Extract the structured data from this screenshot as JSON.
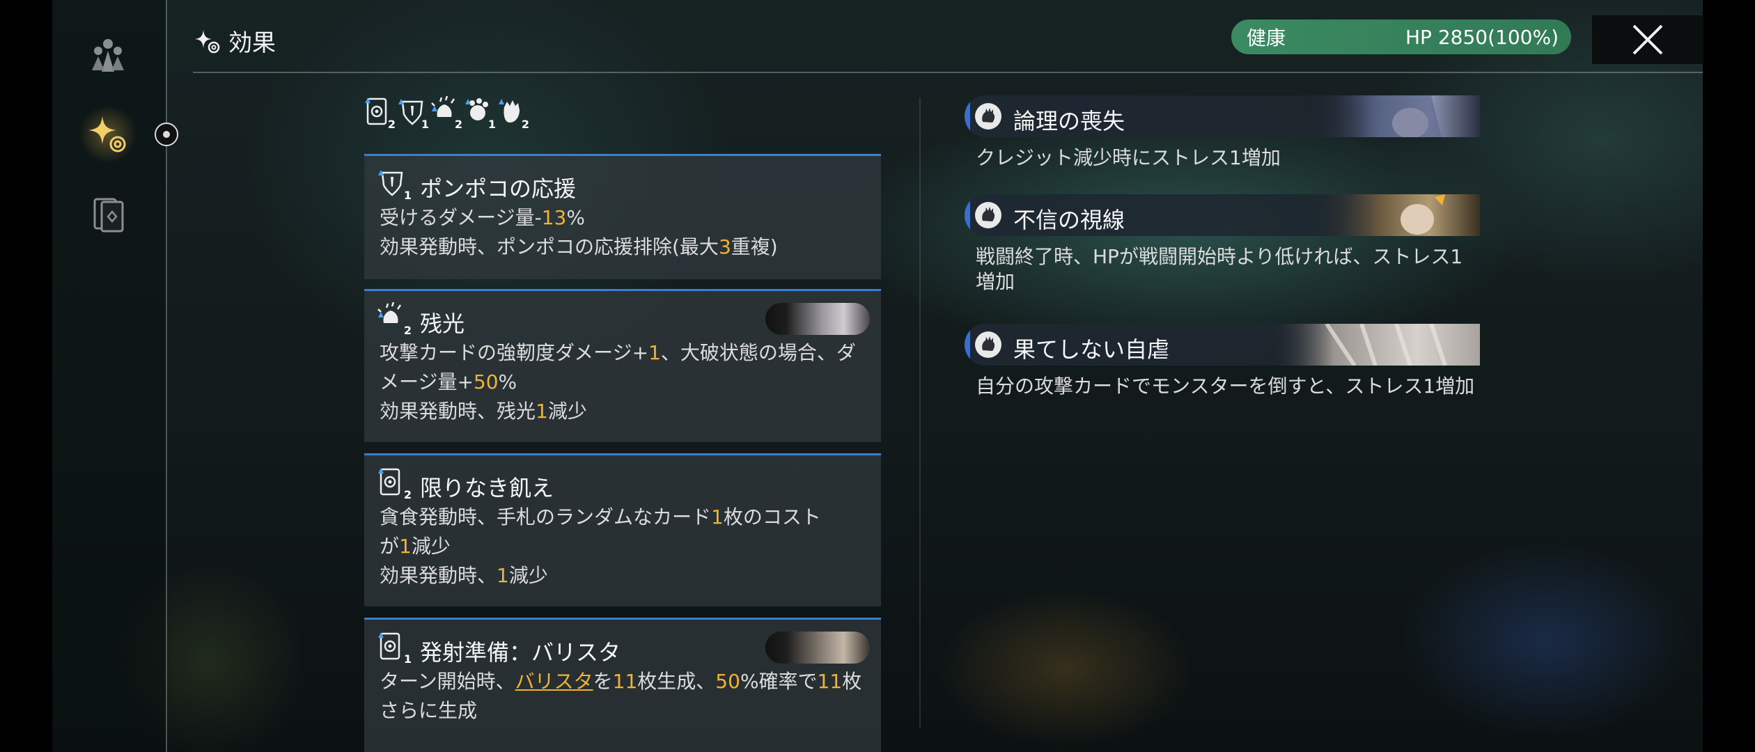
{
  "header": {
    "title": "効果"
  },
  "status": {
    "label": "健康",
    "hp": "HP 2850(100%)"
  },
  "buffs": [
    {
      "name": "hunger-icon",
      "count": "2"
    },
    {
      "name": "ponpoko-icon",
      "count": "1"
    },
    {
      "name": "afterglow-icon",
      "count": "2"
    },
    {
      "name": "paw-icon",
      "count": "1"
    },
    {
      "name": "fist-icon",
      "count": "2"
    }
  ],
  "cards": [
    {
      "icon": "ponpoko-icon",
      "count": "1",
      "title": "ポンポコの応援",
      "lines": [
        [
          {
            "t": "受けるダメージ量-"
          },
          {
            "t": "13",
            "c": "hl"
          },
          {
            "t": "%"
          }
        ],
        [
          {
            "t": "効果発動時、ポンポコの応援排除(最大"
          },
          {
            "t": "3",
            "c": "hl"
          },
          {
            "t": "重複)"
          }
        ]
      ]
    },
    {
      "icon": "afterglow-icon",
      "count": "2",
      "title": "残光",
      "lines": [
        [
          {
            "t": "攻撃カードの強靭度ダメージ+"
          },
          {
            "t": "1",
            "c": "hl"
          },
          {
            "t": "、大破状態の場合、ダ"
          }
        ],
        [
          {
            "t": "メージ量+"
          },
          {
            "t": "50",
            "c": "hl"
          },
          {
            "t": "%"
          }
        ],
        [
          {
            "t": "効果発動時、残光"
          },
          {
            "t": "1",
            "c": "hl"
          },
          {
            "t": "減少"
          }
        ]
      ]
    },
    {
      "icon": "hunger-icon",
      "count": "2",
      "title": "限りなき飢え",
      "lines": [
        [
          {
            "t": "貪食発動時、手札のランダムなカード"
          },
          {
            "t": "1",
            "c": "hl"
          },
          {
            "t": "枚のコスト"
          }
        ],
        [
          {
            "t": "が"
          },
          {
            "t": "1",
            "c": "hl"
          },
          {
            "t": "減少"
          }
        ],
        [
          {
            "t": "効果発動時、"
          },
          {
            "t": "1",
            "c": "hl"
          },
          {
            "t": "減少"
          }
        ]
      ]
    },
    {
      "icon": "hunger-icon",
      "count": "1",
      "title": "発射準備：バリスタ",
      "lines": [
        [
          {
            "t": "ターン開始時、"
          },
          {
            "t": "バリスタ",
            "c": "link"
          },
          {
            "t": "を"
          },
          {
            "t": "11",
            "c": "hl"
          },
          {
            "t": "枚生成、"
          },
          {
            "t": "50",
            "c": "hl"
          },
          {
            "t": "%確率で"
          },
          {
            "t": "11",
            "c": "hl"
          },
          {
            "t": "枚"
          }
        ],
        [
          {
            "t": "さらに生成"
          }
        ]
      ]
    }
  ],
  "effects": [
    {
      "title": "論理の喪失",
      "desc": "クレジット減少時にストレス1増加"
    },
    {
      "title": "不信の視線",
      "desc": "戦闘終了時、HPが戦闘開始時より低ければ、ストレス1増加"
    },
    {
      "title": "果てしない自虐",
      "desc": "自分の攻撃カードでモンスターを倒すと、ストレス1増加"
    }
  ],
  "colors": {
    "accent_blue": "#3a7fd0",
    "highlight": "#f2b233",
    "health_green": "#3a8a62"
  }
}
